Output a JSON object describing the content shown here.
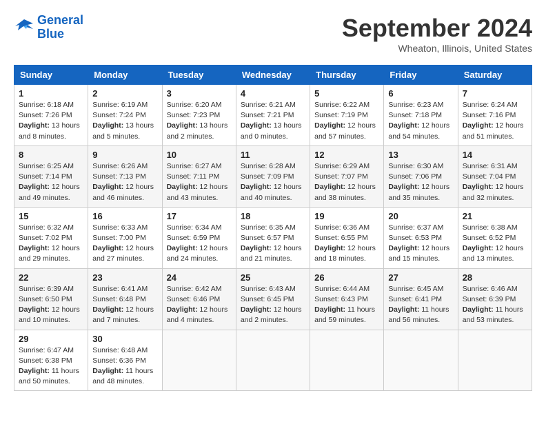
{
  "header": {
    "logo_line1": "General",
    "logo_line2": "Blue",
    "month": "September 2024",
    "location": "Wheaton, Illinois, United States"
  },
  "days_of_week": [
    "Sunday",
    "Monday",
    "Tuesday",
    "Wednesday",
    "Thursday",
    "Friday",
    "Saturday"
  ],
  "weeks": [
    [
      {
        "day": 1,
        "info": "Sunrise: 6:18 AM\nSunset: 7:26 PM\nDaylight: 13 hours and 8 minutes."
      },
      {
        "day": 2,
        "info": "Sunrise: 6:19 AM\nSunset: 7:24 PM\nDaylight: 13 hours and 5 minutes."
      },
      {
        "day": 3,
        "info": "Sunrise: 6:20 AM\nSunset: 7:23 PM\nDaylight: 13 hours and 2 minutes."
      },
      {
        "day": 4,
        "info": "Sunrise: 6:21 AM\nSunset: 7:21 PM\nDaylight: 13 hours and 0 minutes."
      },
      {
        "day": 5,
        "info": "Sunrise: 6:22 AM\nSunset: 7:19 PM\nDaylight: 12 hours and 57 minutes."
      },
      {
        "day": 6,
        "info": "Sunrise: 6:23 AM\nSunset: 7:18 PM\nDaylight: 12 hours and 54 minutes."
      },
      {
        "day": 7,
        "info": "Sunrise: 6:24 AM\nSunset: 7:16 PM\nDaylight: 12 hours and 51 minutes."
      }
    ],
    [
      {
        "day": 8,
        "info": "Sunrise: 6:25 AM\nSunset: 7:14 PM\nDaylight: 12 hours and 49 minutes."
      },
      {
        "day": 9,
        "info": "Sunrise: 6:26 AM\nSunset: 7:13 PM\nDaylight: 12 hours and 46 minutes."
      },
      {
        "day": 10,
        "info": "Sunrise: 6:27 AM\nSunset: 7:11 PM\nDaylight: 12 hours and 43 minutes."
      },
      {
        "day": 11,
        "info": "Sunrise: 6:28 AM\nSunset: 7:09 PM\nDaylight: 12 hours and 40 minutes."
      },
      {
        "day": 12,
        "info": "Sunrise: 6:29 AM\nSunset: 7:07 PM\nDaylight: 12 hours and 38 minutes."
      },
      {
        "day": 13,
        "info": "Sunrise: 6:30 AM\nSunset: 7:06 PM\nDaylight: 12 hours and 35 minutes."
      },
      {
        "day": 14,
        "info": "Sunrise: 6:31 AM\nSunset: 7:04 PM\nDaylight: 12 hours and 32 minutes."
      }
    ],
    [
      {
        "day": 15,
        "info": "Sunrise: 6:32 AM\nSunset: 7:02 PM\nDaylight: 12 hours and 29 minutes."
      },
      {
        "day": 16,
        "info": "Sunrise: 6:33 AM\nSunset: 7:00 PM\nDaylight: 12 hours and 27 minutes."
      },
      {
        "day": 17,
        "info": "Sunrise: 6:34 AM\nSunset: 6:59 PM\nDaylight: 12 hours and 24 minutes."
      },
      {
        "day": 18,
        "info": "Sunrise: 6:35 AM\nSunset: 6:57 PM\nDaylight: 12 hours and 21 minutes."
      },
      {
        "day": 19,
        "info": "Sunrise: 6:36 AM\nSunset: 6:55 PM\nDaylight: 12 hours and 18 minutes."
      },
      {
        "day": 20,
        "info": "Sunrise: 6:37 AM\nSunset: 6:53 PM\nDaylight: 12 hours and 15 minutes."
      },
      {
        "day": 21,
        "info": "Sunrise: 6:38 AM\nSunset: 6:52 PM\nDaylight: 12 hours and 13 minutes."
      }
    ],
    [
      {
        "day": 22,
        "info": "Sunrise: 6:39 AM\nSunset: 6:50 PM\nDaylight: 12 hours and 10 minutes."
      },
      {
        "day": 23,
        "info": "Sunrise: 6:41 AM\nSunset: 6:48 PM\nDaylight: 12 hours and 7 minutes."
      },
      {
        "day": 24,
        "info": "Sunrise: 6:42 AM\nSunset: 6:46 PM\nDaylight: 12 hours and 4 minutes."
      },
      {
        "day": 25,
        "info": "Sunrise: 6:43 AM\nSunset: 6:45 PM\nDaylight: 12 hours and 2 minutes."
      },
      {
        "day": 26,
        "info": "Sunrise: 6:44 AM\nSunset: 6:43 PM\nDaylight: 11 hours and 59 minutes."
      },
      {
        "day": 27,
        "info": "Sunrise: 6:45 AM\nSunset: 6:41 PM\nDaylight: 11 hours and 56 minutes."
      },
      {
        "day": 28,
        "info": "Sunrise: 6:46 AM\nSunset: 6:39 PM\nDaylight: 11 hours and 53 minutes."
      }
    ],
    [
      {
        "day": 29,
        "info": "Sunrise: 6:47 AM\nSunset: 6:38 PM\nDaylight: 11 hours and 50 minutes."
      },
      {
        "day": 30,
        "info": "Sunrise: 6:48 AM\nSunset: 6:36 PM\nDaylight: 11 hours and 48 minutes."
      },
      null,
      null,
      null,
      null,
      null
    ]
  ]
}
